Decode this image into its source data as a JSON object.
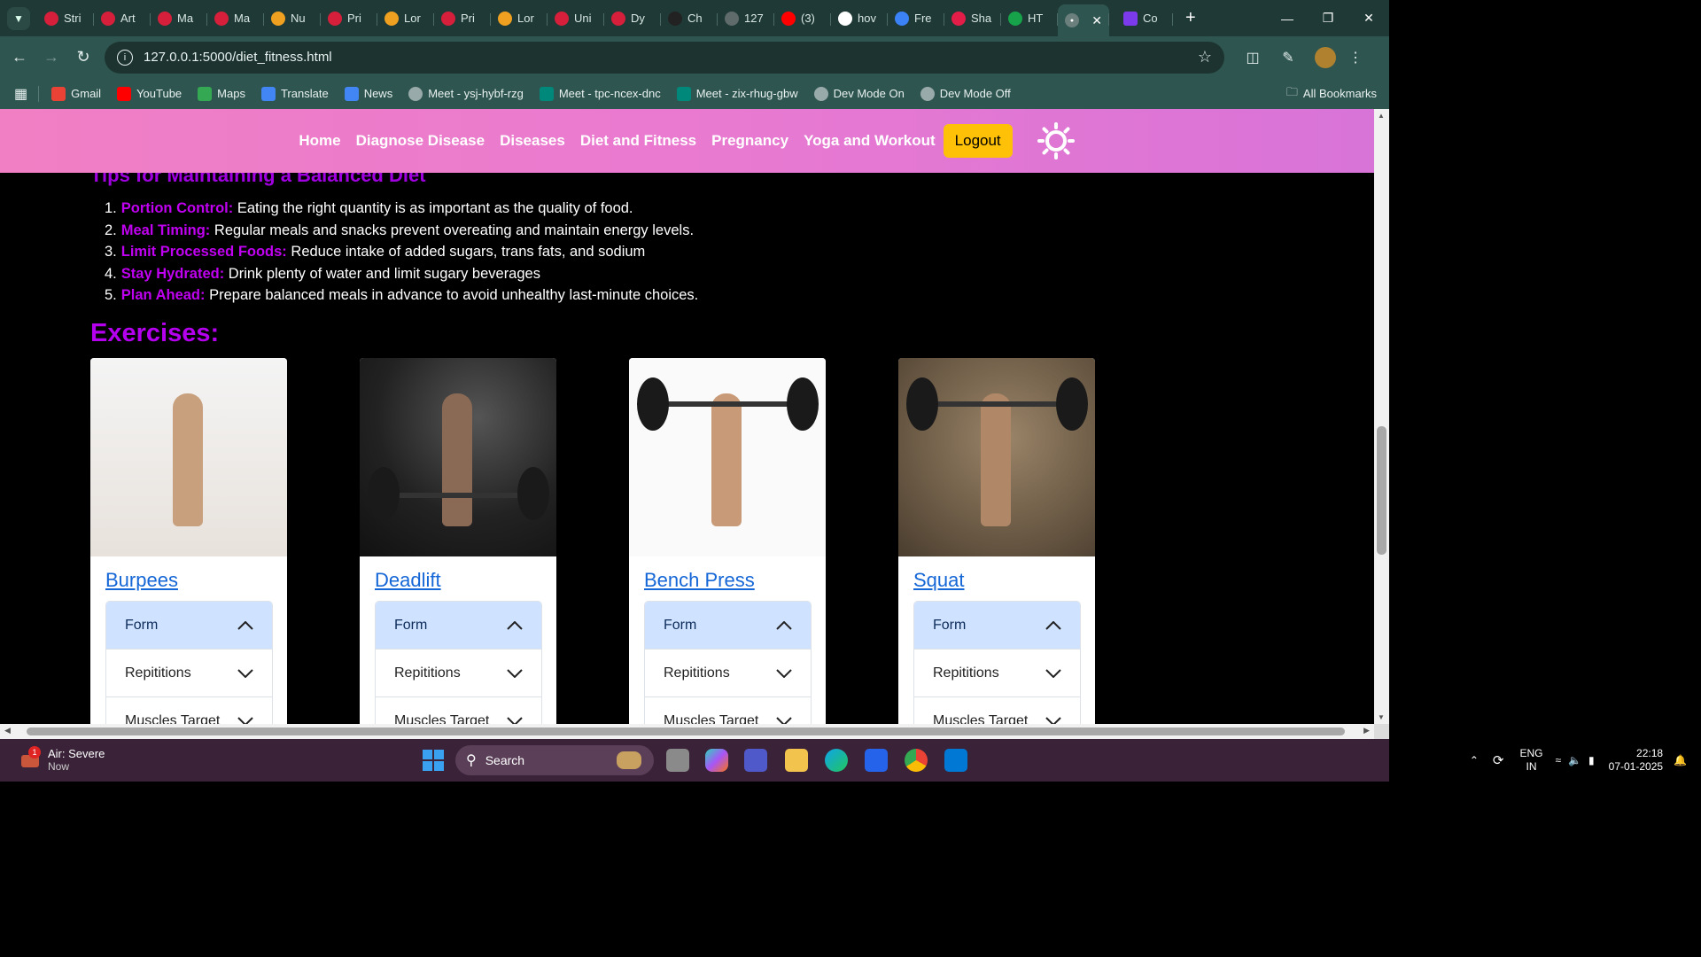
{
  "browser": {
    "tabs": [
      {
        "label": "Stri",
        "favicon": "tuf-icon",
        "color": "#d61f3a"
      },
      {
        "label": "Art",
        "favicon": "tuf-icon",
        "color": "#d61f3a"
      },
      {
        "label": "Ma",
        "favicon": "tuf-icon",
        "color": "#d61f3a"
      },
      {
        "label": "Ma",
        "favicon": "tuf-icon",
        "color": "#d61f3a"
      },
      {
        "label": "Nu",
        "favicon": "code-icon",
        "color": "#f0a020"
      },
      {
        "label": "Pri",
        "favicon": "tuf-icon",
        "color": "#d61f3a"
      },
      {
        "label": "Lor",
        "favicon": "code-icon",
        "color": "#f0a020"
      },
      {
        "label": "Pri",
        "favicon": "tuf-icon",
        "color": "#d61f3a"
      },
      {
        "label": "Lor",
        "favicon": "code-icon",
        "color": "#f0a020"
      },
      {
        "label": "Uni",
        "favicon": "tuf-icon",
        "color": "#d61f3a"
      },
      {
        "label": "Dy",
        "favicon": "tuf-icon",
        "color": "#d61f3a"
      },
      {
        "label": "Ch",
        "favicon": "chatgpt-icon",
        "color": "#222222"
      },
      {
        "label": "127",
        "favicon": "globe-icon",
        "color": "#5f6b6a"
      },
      {
        "label": "(3)",
        "favicon": "youtube-icon",
        "color": "#ff0000"
      },
      {
        "label": "hov",
        "favicon": "google-icon",
        "color": "#ffffff"
      },
      {
        "label": "Fre",
        "favicon": "drive-icon",
        "color": "#3b82f6"
      },
      {
        "label": "Sha",
        "favicon": "share-icon",
        "color": "#e11d48"
      },
      {
        "label": "HT",
        "favicon": "w-icon",
        "color": "#16a34a"
      }
    ],
    "active_tab": {
      "favicon": "globe-icon",
      "close": "✕"
    },
    "after_tab": {
      "label": "Co",
      "favicon": "list-icon",
      "color": "#7c3aed"
    },
    "url": "127.0.0.1:5000/diet_fitness.html",
    "bookmarks": [
      {
        "label": "Gmail",
        "icon": "gmail-icon",
        "color": "#ea4335"
      },
      {
        "label": "YouTube",
        "icon": "youtube-icon",
        "color": "#ff0000"
      },
      {
        "label": "Maps",
        "icon": "maps-icon",
        "color": "#34a853"
      },
      {
        "label": "Translate",
        "icon": "translate-icon",
        "color": "#4285f4"
      },
      {
        "label": "News",
        "icon": "news-icon",
        "color": "#4285f4"
      },
      {
        "label": "Meet - ysj-hybf-rzg",
        "icon": "globe-icon",
        "color": "#9aa"
      },
      {
        "label": "Meet - tpc-ncex-dnc",
        "icon": "meet-icon",
        "color": "#00897b"
      },
      {
        "label": "Meet - zix-rhug-gbw",
        "icon": "meet-icon",
        "color": "#00897b"
      },
      {
        "label": "Dev Mode On",
        "icon": "globe-icon",
        "color": "#9aa"
      },
      {
        "label": "Dev Mode Off",
        "icon": "globe-icon",
        "color": "#9aa"
      }
    ],
    "all_bookmarks": "All Bookmarks"
  },
  "site_nav": {
    "links": [
      "Home",
      "Diagnose Disease",
      "Diseases",
      "Diet and Fitness",
      "Pregnancy",
      "Yoga and Workout"
    ],
    "logout": "Logout",
    "gradient": [
      "#f07fc4",
      "#d873d8"
    ]
  },
  "tips": {
    "title": "Tips for Maintaining a Balanced Diet",
    "items": [
      {
        "num": "1.",
        "term": "Portion Control:",
        "text": " Eating the right quantity is as important as the quality of food."
      },
      {
        "num": "2.",
        "term": "Meal Timing:",
        "text": " Regular meals and snacks prevent overeating and maintain energy levels."
      },
      {
        "num": "3.",
        "term": "Limit Processed Foods:",
        "text": " Reduce intake of added sugars, trans fats, and sodium"
      },
      {
        "num": "4.",
        "term": "Stay Hydrated:",
        "text": " Drink plenty of water and limit sugary beverages"
      },
      {
        "num": "5.",
        "term": "Plan Ahead:",
        "text": " Prepare balanced meals in advance to avoid unhealthy last-minute choices."
      }
    ]
  },
  "exercises": {
    "title": "Exercises:",
    "accordion": [
      "Form",
      "Repititions",
      "Muscles Target"
    ],
    "cards": [
      {
        "name": "Burpees",
        "image": "burpees-photo"
      },
      {
        "name": "Deadlift",
        "image": "deadlift-photo"
      },
      {
        "name": "Bench Press",
        "image": "bench-press-photo"
      },
      {
        "name": "Squat",
        "image": "squat-photo"
      }
    ]
  },
  "taskbar": {
    "weather_title": "Air: Severe",
    "weather_sub": "Now",
    "weather_badge": "1",
    "search": "Search",
    "lang_top": "ENG",
    "lang_bottom": "IN",
    "time": "22:18",
    "date": "07-01-2025"
  }
}
